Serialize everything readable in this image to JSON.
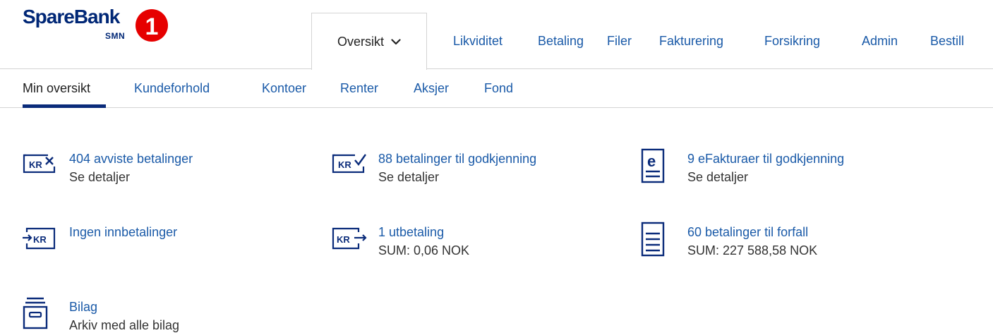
{
  "brand": {
    "name": "SpareBank",
    "number": "1",
    "sub": "SMN",
    "color": "#002776",
    "disc_color": "#e60000"
  },
  "top_nav": {
    "active": "Oversikt",
    "items": [
      "Likviditet",
      "Betaling",
      "Filer",
      "Fakturering",
      "Forsikring",
      "Admin",
      "Bestill"
    ]
  },
  "sub_nav": {
    "items": [
      "Min oversikt",
      "Kundeforhold",
      "Kontoer",
      "Renter",
      "Aksjer",
      "Fond"
    ],
    "active_index": 0
  },
  "tiles": [
    {
      "icon": "kr-rejected-icon",
      "title": "404 avviste betalinger",
      "sub": "Se detaljer"
    },
    {
      "icon": "kr-approve-icon",
      "title": "88 betalinger til godkjenning",
      "sub": "Se detaljer"
    },
    {
      "icon": "efaktura-icon",
      "title": "9 eFakturaer til godkjenning",
      "sub": "Se detaljer"
    },
    {
      "icon": "kr-incoming-icon",
      "title": "Ingen innbetalinger",
      "sub": ""
    },
    {
      "icon": "kr-outgoing-icon",
      "title": "1 utbetaling",
      "sub": "SUM: 0,06 NOK"
    },
    {
      "icon": "document-list-icon",
      "title": "60 betalinger til forfall",
      "sub": "SUM: 227 588,58 NOK"
    },
    {
      "icon": "archive-tray-icon",
      "title": "Bilag",
      "sub": "Arkiv med alle bilag"
    }
  ],
  "icon_glyphs": {
    "kr": "KR",
    "e": "e"
  },
  "colors": {
    "link": "#1a5aa8",
    "text": "#333333",
    "icon": "#0a2b7a",
    "border": "#d4d4d4"
  }
}
